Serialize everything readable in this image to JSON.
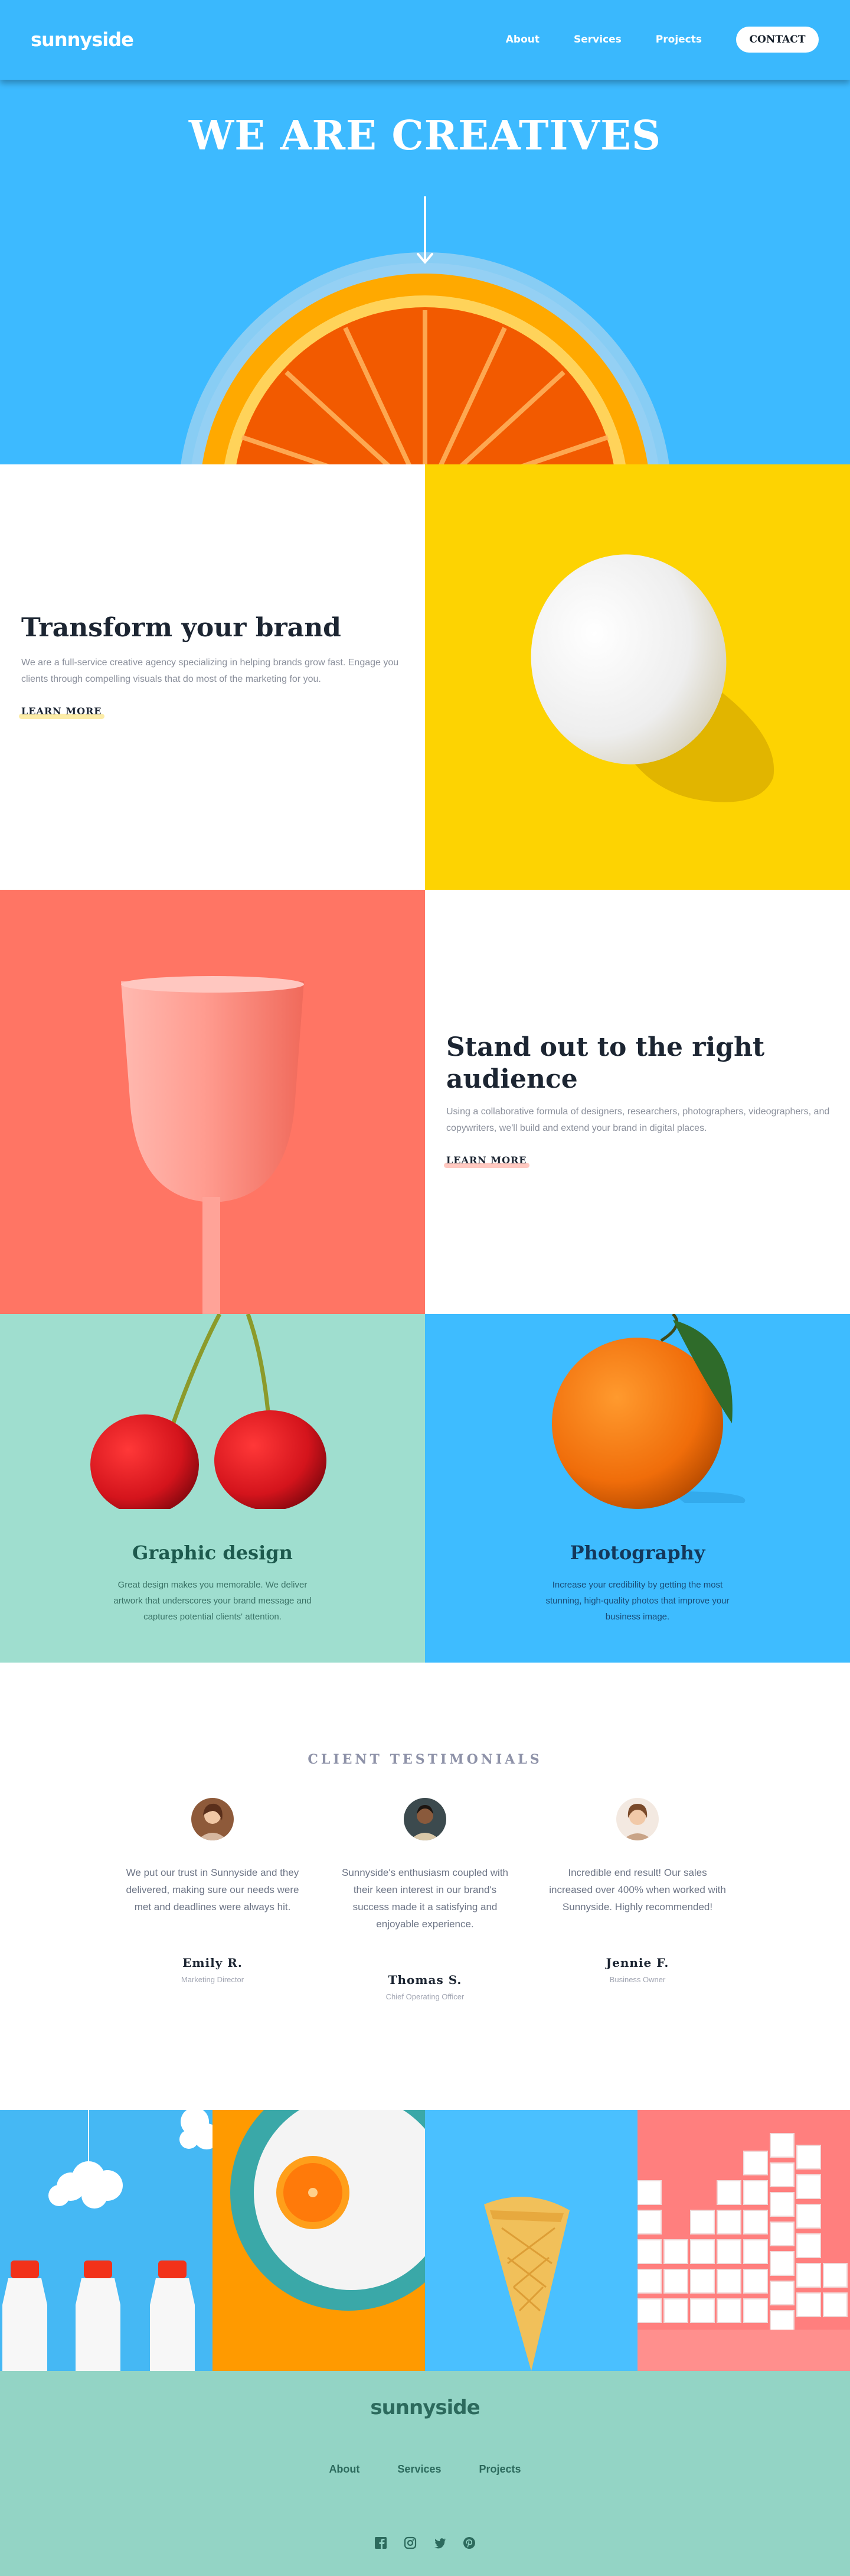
{
  "header": {
    "logo": "sunnyside",
    "nav": [
      "About",
      "Services",
      "Projects"
    ],
    "cta": "CONTACT"
  },
  "hero": {
    "title": "WE ARE CREATIVES"
  },
  "transform": {
    "title": "Transform your brand",
    "text": "We are a full-service creative agency specializing in helping brands grow fast. Engage you clients through compelling visuals that do most of the marketing for you.",
    "link": "LEARN MORE",
    "accent": "#fad400"
  },
  "standout": {
    "title": "Stand out to the right audience",
    "text": "Using a collaborative formula of designers, researchers, photographers, videographers, and copywriters, we'll build and extend your brand in digital places.",
    "link": "LEARN MORE",
    "accent": "#fe7865"
  },
  "graphic": {
    "title": "Graphic design",
    "text": "Great design makes you memorable. We deliver artwork that underscores your brand message and captures potential clients' attention."
  },
  "photo": {
    "title": "Photography",
    "text": "Increase your credibility by getting the most stunning, high-quality photos that improve your business image."
  },
  "testimonials": {
    "heading": "CLIENT TESTIMONIALS",
    "items": [
      {
        "quote": "We put our trust in Sunnyside and they delivered, making sure our needs were met and deadlines were always hit.",
        "name": "Emily R.",
        "role": "Marketing Director"
      },
      {
        "quote": "Sunnyside's enthusiasm coupled with their keen interest in our brand's success made it a satisfying and enjoyable experience.",
        "name": "Thomas S.",
        "role": "Chief Operating Officer"
      },
      {
        "quote": "Incredible end result! Our sales increased over 400% when worked with Sunnyside. Highly recommended!",
        "name": "Jennie F.",
        "role": "Business Owner"
      }
    ]
  },
  "footer": {
    "logo": "sunnyside",
    "links": [
      "About",
      "Services",
      "Projects"
    ],
    "social": [
      "facebook-icon",
      "instagram-icon",
      "twitter-icon",
      "pinterest-icon"
    ]
  },
  "colors": {
    "hero_blue": "#3dbaff",
    "yellow": "#fdd302",
    "coral": "#fe7865",
    "mint": "#9fdecf",
    "footer_mint": "#93d4c5",
    "dark": "#1c2532"
  }
}
